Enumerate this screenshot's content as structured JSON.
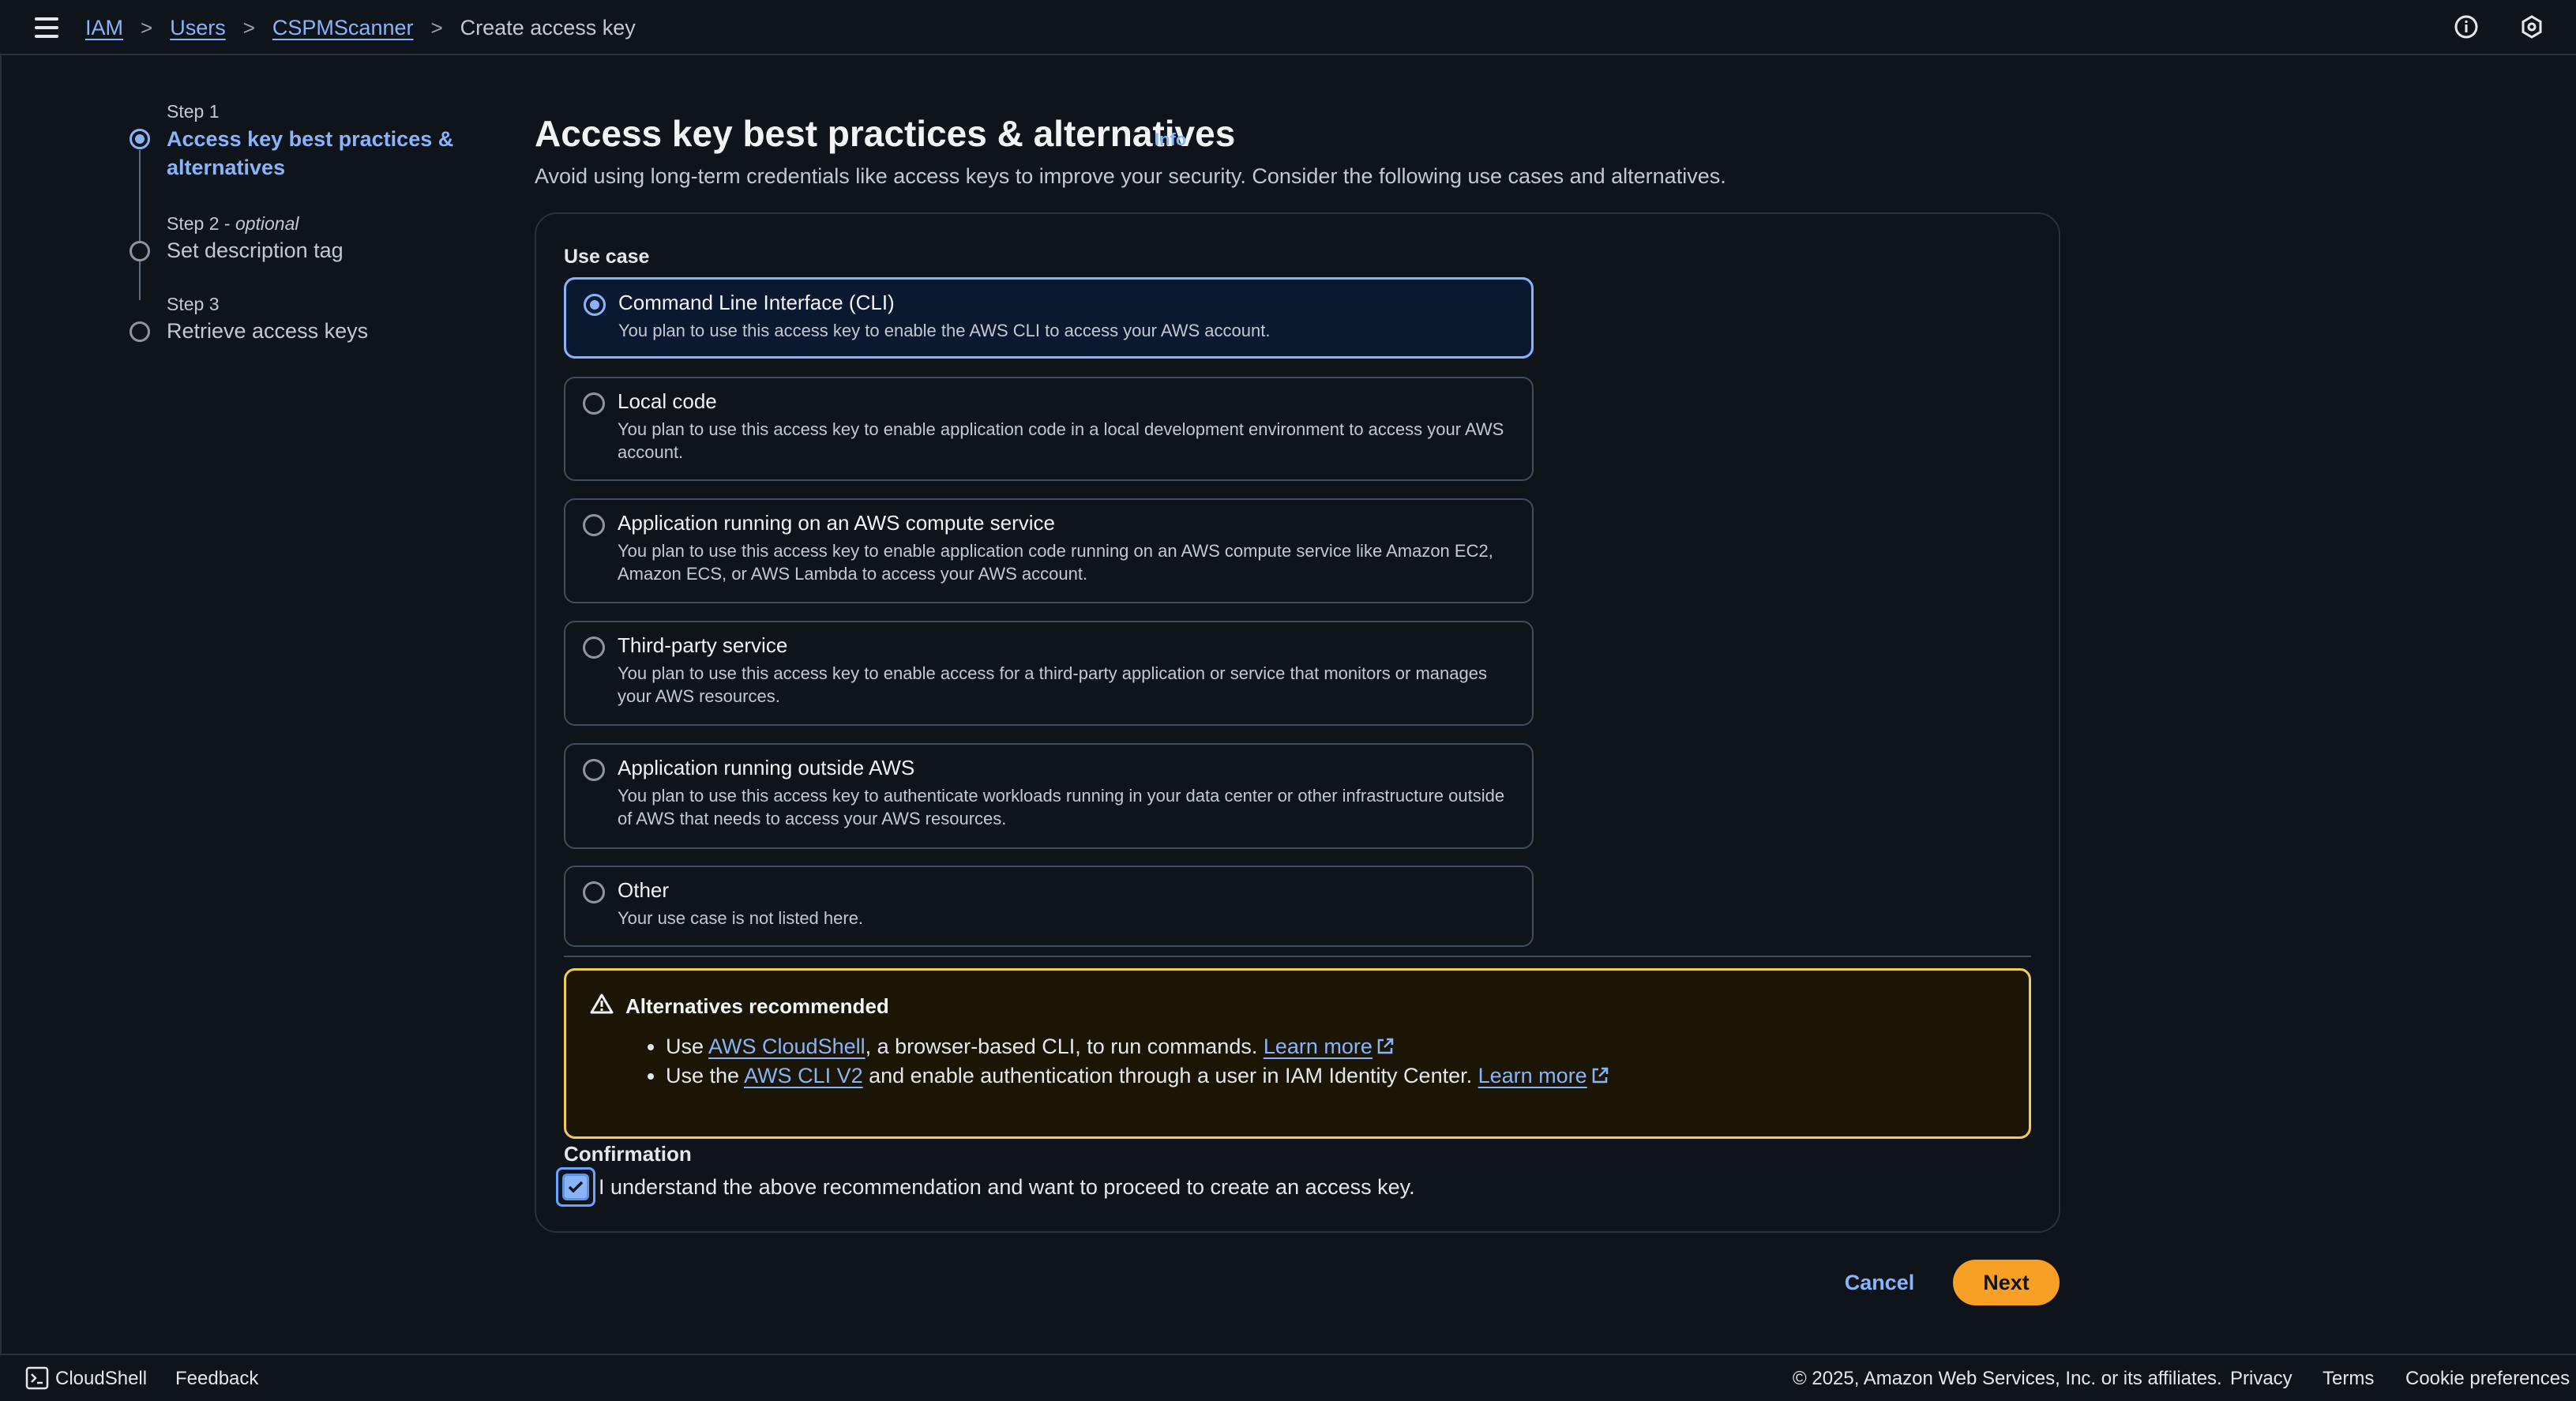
{
  "breadcrumb": {
    "items": [
      "IAM",
      "Users",
      "CSPMScanner"
    ],
    "current": "Create access key"
  },
  "steps": [
    {
      "label": "Step 1",
      "title_line1": "Access key best practices &",
      "title_line2": "alternatives",
      "active": true
    },
    {
      "label": "Step 2 - ",
      "label_optional": "optional",
      "title": "Set description tag",
      "active": false
    },
    {
      "label": "Step 3",
      "title": "Retrieve access keys",
      "active": false
    }
  ],
  "page": {
    "title": "Access key best practices & alternatives",
    "info": "Info",
    "description": "Avoid using long-term credentials like access keys to improve your security. Consider the following use cases and alternatives."
  },
  "use_case": {
    "label": "Use case",
    "selected": "Command Line Interface (CLI)",
    "options": [
      {
        "title": "Command Line Interface (CLI)",
        "description": "You plan to use this access key to enable the AWS CLI to access your AWS account."
      },
      {
        "title": "Local code",
        "description": "You plan to use this access key to enable application code in a local development environment to access your AWS account."
      },
      {
        "title": "Application running on an AWS compute service",
        "description": "You plan to use this access key to enable application code running on an AWS compute service like Amazon EC2, Amazon ECS, or AWS Lambda to access your AWS account."
      },
      {
        "title": "Third-party service",
        "description": "You plan to use this access key to enable access for a third-party application or service that monitors or manages your AWS resources."
      },
      {
        "title": "Application running outside AWS",
        "description": "You plan to use this access key to authenticate workloads running in your data center or other infrastructure outside of AWS that needs to access your AWS resources."
      },
      {
        "title": "Other",
        "description": "Your use case is not listed here."
      }
    ]
  },
  "alert": {
    "title": "Alternatives recommended",
    "item1": {
      "prefix": "Use ",
      "link": "AWS CloudShell",
      "middle": ", a browser-based CLI, to run commands. ",
      "learn_more": "Learn more"
    },
    "item2": {
      "prefix": "Use the ",
      "link": "AWS CLI V2",
      "middle": " and enable authentication through a user in IAM Identity Center. ",
      "learn_more": "Learn more"
    }
  },
  "confirmation": {
    "label": "Confirmation",
    "checkbox_text": "I understand the above recommendation and want to proceed to create an access key.",
    "checked": true
  },
  "actions": {
    "cancel": "Cancel",
    "next": "Next"
  },
  "footer": {
    "cloudshell": "CloudShell",
    "feedback": "Feedback",
    "copyright": "© 2025, Amazon Web Services, Inc. or its affiliates.",
    "privacy": "Privacy",
    "terms": "Terms",
    "cookies": "Cookie preferences"
  },
  "colors": {
    "background": "#0f141a",
    "link": "#89b4fa",
    "primary_button": "#f89f26",
    "warning_border": "#f2cd54"
  }
}
